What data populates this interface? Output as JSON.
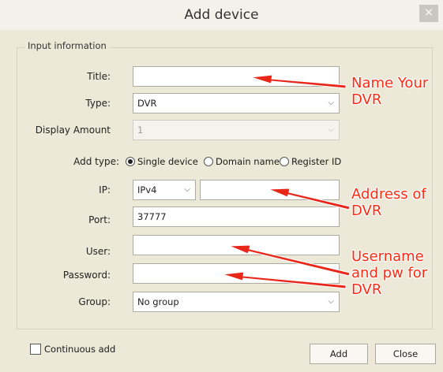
{
  "dialog": {
    "title": "Add device",
    "close_glyph": "×",
    "group_label": "Input information"
  },
  "form": {
    "title_label": "Title:",
    "title_value": "",
    "type_label": "Type:",
    "type_value": "DVR",
    "display_amount_label": "Display Amount",
    "display_amount_value": "1",
    "add_type_label": "Add type:",
    "add_type_options": [
      "Single device",
      "Domain name",
      "Register ID"
    ],
    "add_type_selected": "Single device",
    "ip_label": "IP:",
    "ip_version": "IPv4",
    "ip_value": "",
    "port_label": "Port:",
    "port_value": "37777",
    "user_label": "User:",
    "user_value": "",
    "password_label": "Password:",
    "password_value": "",
    "group_label": "Group:",
    "group_value": "No group"
  },
  "footer": {
    "continuous_add_label": "Continuous add",
    "continuous_add_checked": false,
    "add_button": "Add",
    "close_button": "Close"
  },
  "annotations": {
    "name_line1": "Name Your",
    "name_line2": "DVR",
    "address_line1": "Address of",
    "address_line2": "DVR",
    "user_line1": "Username",
    "user_line2": "and pw for",
    "user_line3": "DVR",
    "color": "#ff2a12"
  },
  "icons": {
    "dropdown": "chevron-down-icon"
  }
}
